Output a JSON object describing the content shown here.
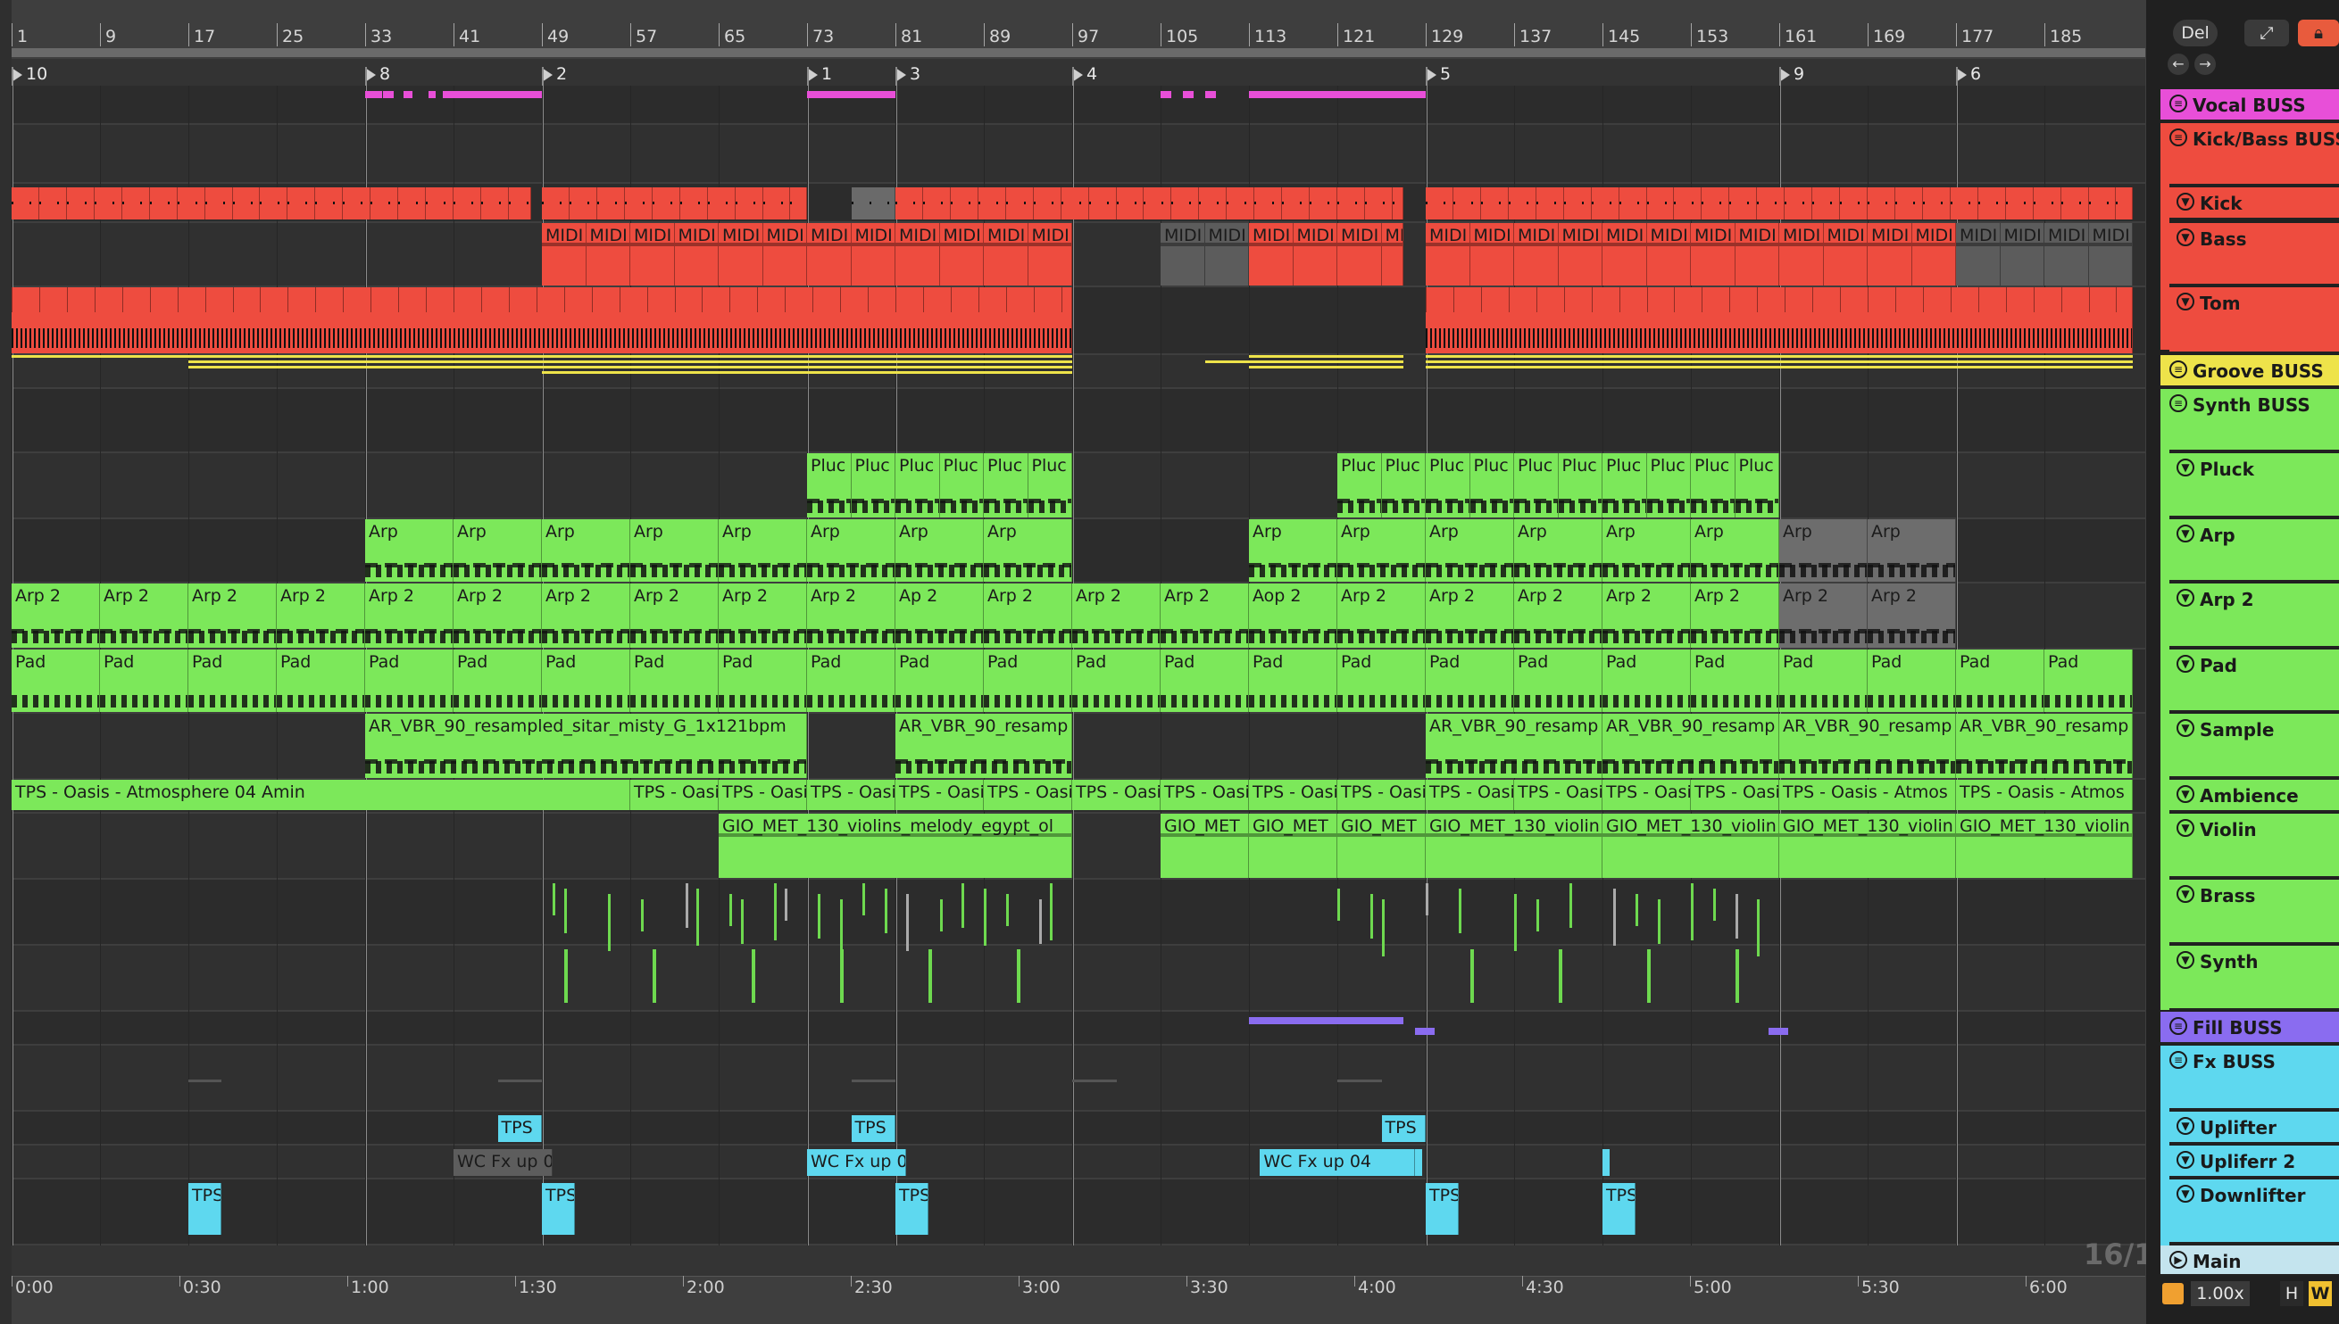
{
  "ruler": {
    "bars": [
      "1",
      "9",
      "17",
      "25",
      "33",
      "41",
      "49",
      "57",
      "65",
      "73",
      "81",
      "89",
      "97",
      "105",
      "113",
      "121",
      "129",
      "137",
      "145",
      "153",
      "161",
      "169",
      "177",
      "185"
    ]
  },
  "locators": [
    {
      "label": "10"
    },
    {
      "label": "8"
    },
    {
      "label": "2"
    },
    {
      "label": "1"
    },
    {
      "label": "3"
    },
    {
      "label": "4"
    },
    {
      "label": "5"
    },
    {
      "label": "9"
    },
    {
      "label": "6"
    }
  ],
  "timeline": {
    "times": [
      "0:00",
      "0:30",
      "1:00",
      "1:30",
      "2:00",
      "2:30",
      "3:00",
      "3:30",
      "4:00",
      "4:30",
      "5:00",
      "5:30",
      "6:00"
    ],
    "position_overlay": "16/1"
  },
  "clips": {
    "midi": "MIDI",
    "pluck": "Pluc",
    "arp": "Arp",
    "arp2": "Arp 2",
    "ap2": "Ap 2",
    "aop2": "Aop 2",
    "pad": "Pad",
    "sample_long": "AR_VBR_90_resampled_sitar_misty_G_1x121bpm",
    "sample_short": "AR_VBR_90_resamp",
    "ambience_long": "TPS - Oasis - Atmosphere 04 Amin",
    "ambience_short": "TPS - Oasi",
    "ambience_mid": "TPS - Oasis - Atmos",
    "ambience_a": "TPS - Oasis",
    "violin_long": "GIO_MET_130_violins_melody_egypt_ol",
    "violin_short": "GIO_MET",
    "violin_mid": "GIO_MET_130_violin",
    "fx_tps": "TPS",
    "fx_wc": "WC Fx up 0",
    "fx_wc4": "WC Fx up 04",
    "fx_tp": "TPS"
  },
  "header": {
    "del_label": "Del",
    "expand_icon": "expand-icon",
    "lock_icon": "lock-icon",
    "back_icon": "arrow-left-icon",
    "fwd_icon": "arrow-right-icon"
  },
  "tracks": [
    {
      "name": "Vocal BUSS",
      "color": "#e84fd8",
      "type": "group"
    },
    {
      "name": "Kick/Bass BUSS",
      "color": "#ee4c3f",
      "type": "group"
    },
    {
      "name": "Kick",
      "color": "#ee4c3f",
      "type": "track"
    },
    {
      "name": "Bass",
      "color": "#ee4c3f",
      "type": "track"
    },
    {
      "name": "Tom",
      "color": "#ee4c3f",
      "type": "track"
    },
    {
      "name": "Groove BUSS",
      "color": "#eee34a",
      "type": "group"
    },
    {
      "name": "Synth BUSS",
      "color": "#7ce85a",
      "type": "group"
    },
    {
      "name": "Pluck",
      "color": "#7ce85a",
      "type": "track"
    },
    {
      "name": "Arp",
      "color": "#7ce85a",
      "type": "track"
    },
    {
      "name": "Arp 2",
      "color": "#7ce85a",
      "type": "track"
    },
    {
      "name": "Pad",
      "color": "#7ce85a",
      "type": "track"
    },
    {
      "name": "Sample",
      "color": "#7ce85a",
      "type": "track"
    },
    {
      "name": "Ambience",
      "color": "#7ce85a",
      "type": "track"
    },
    {
      "name": "Violin",
      "color": "#7ce85a",
      "type": "track"
    },
    {
      "name": "Brass",
      "color": "#7ce85a",
      "type": "track"
    },
    {
      "name": "Synth",
      "color": "#7ce85a",
      "type": "track"
    },
    {
      "name": "Fill BUSS",
      "color": "#8a6cf0",
      "type": "group"
    },
    {
      "name": "Fx BUSS",
      "color": "#5ed8ef",
      "type": "group"
    },
    {
      "name": "Uplifter",
      "color": "#5ed8ef",
      "type": "track"
    },
    {
      "name": "Upliferr 2",
      "color": "#5ed8ef",
      "type": "track"
    },
    {
      "name": "Downlifter",
      "color": "#5ed8ef",
      "type": "track"
    },
    {
      "name": "Main",
      "color": "#c4e4ee",
      "type": "main"
    }
  ],
  "footer": {
    "zoom": "1.00x",
    "h_label": "H",
    "w_label": "W"
  }
}
